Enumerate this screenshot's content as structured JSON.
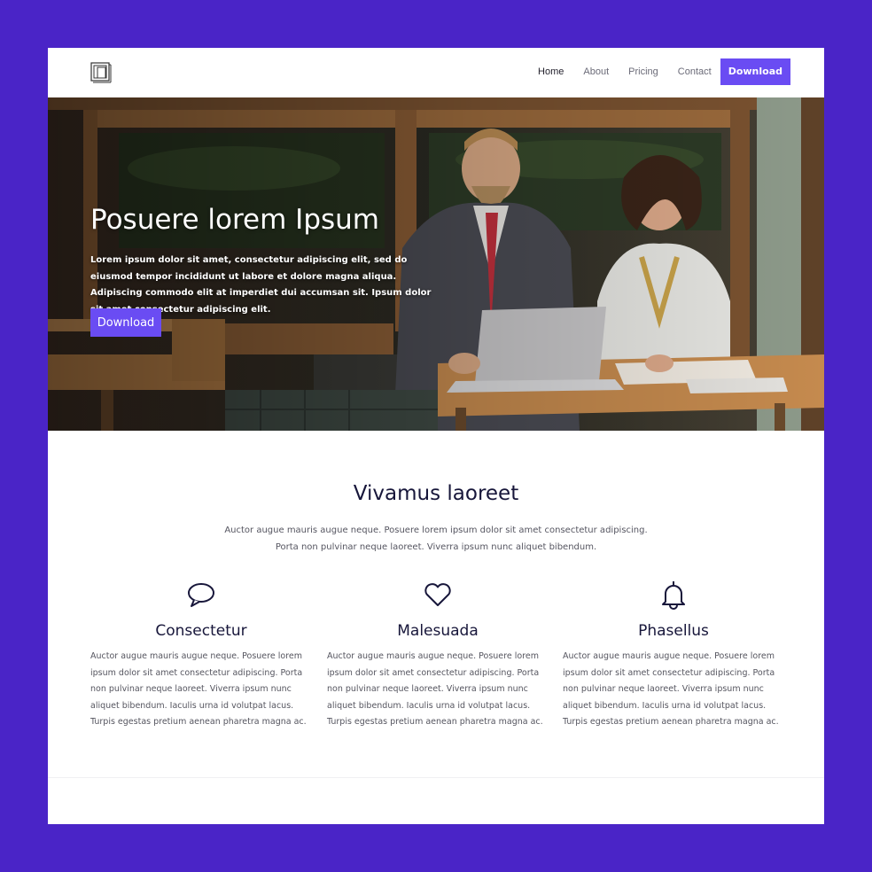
{
  "nav": {
    "logo_icon": "square-logo-icon",
    "items": [
      {
        "label": "Home",
        "active": true
      },
      {
        "label": "About"
      },
      {
        "label": "Pricing"
      },
      {
        "label": "Contact"
      }
    ],
    "cta_label": "Download",
    "accent_color": "#6a4cf3"
  },
  "hero": {
    "title": "Posuere lorem Ipsum",
    "text": "Lorem ipsum dolor sit amet, consectetur adipiscing elit, sed do eiusmod tempor incididunt ut labore et dolore magna aliqua. Adipiscing commodo elit at imperdiet dui accumsan sit. Ipsum dolor sit amet consectetur adipiscing elit.",
    "button_label": "Download",
    "image_description": "photo-of-two-people-at-cafe-table-with-laptop"
  },
  "features_section": {
    "title": "Vivamus laoreet",
    "subtitle_lines": [
      "Auctor augue mauris augue neque. Posuere lorem ipsum dolor sit amet consectetur adipiscing.",
      "Porta non pulvinar neque laoreet. Viverra ipsum nunc aliquet bibendum."
    ],
    "items": [
      {
        "icon": "speech-bubble-icon",
        "title": "Consectetur",
        "text": "Auctor augue mauris augue neque. Posuere lorem ipsum dolor sit amet consectetur adipiscing. Porta non pulvinar neque laoreet. Viverra ipsum nunc aliquet bibendum. Iaculis urna id volutpat lacus. Turpis egestas pretium aenean pharetra magna ac."
      },
      {
        "icon": "heart-icon",
        "title": "Malesuada",
        "text": "Auctor augue mauris augue neque. Posuere lorem ipsum dolor sit amet consectetur adipiscing. Porta non pulvinar neque laoreet. Viverra ipsum nunc aliquet bibendum. Iaculis urna id volutpat lacus. Turpis egestas pretium aenean pharetra magna ac."
      },
      {
        "icon": "bell-icon",
        "title": "Phasellus",
        "text": "Auctor augue mauris augue neque. Posuere lorem ipsum dolor sit amet consectetur adipiscing. Porta non pulvinar neque laoreet. Viverra ipsum nunc aliquet bibendum. Iaculis urna id volutpat lacus. Turpis egestas pretium aenean pharetra magna ac."
      }
    ]
  },
  "colors": {
    "frame_background": "#4a24c7",
    "heading_color": "#17163a"
  }
}
